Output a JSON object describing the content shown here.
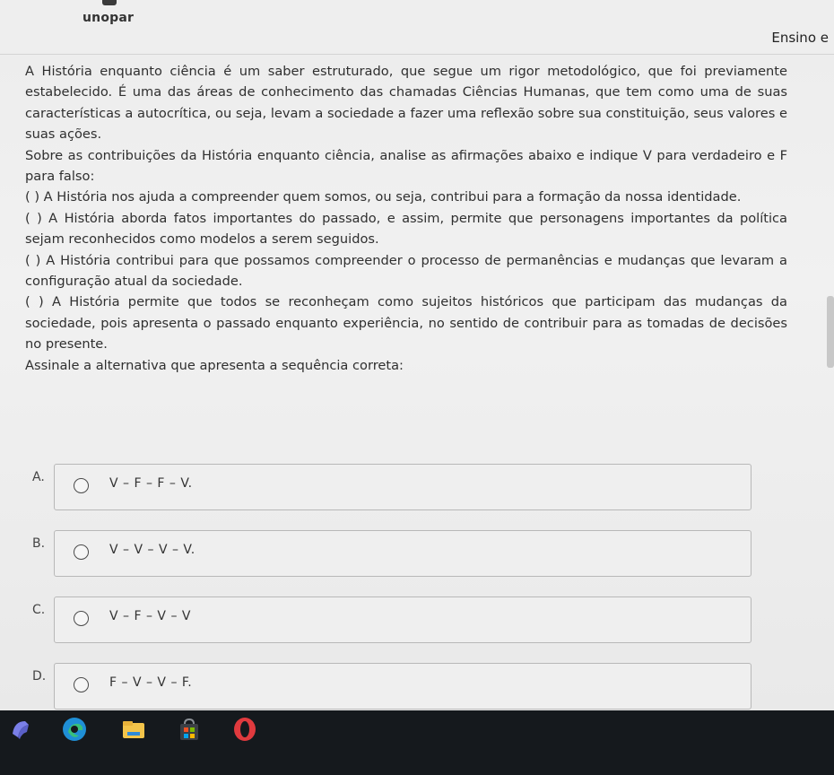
{
  "header": {
    "logo_text": "unopar",
    "course_label": "Ensino e"
  },
  "question": {
    "paragraphs": [
      "A História enquanto ciência é um saber estruturado, que segue um rigor metodológico, que foi previamente estabelecido. É uma das áreas de conhecimento das chamadas Ciências Humanas, que tem como uma de suas características a autocrítica, ou seja, levam a sociedade a fazer uma reflexão sobre sua constituição, seus valores e suas ações.",
      "Sobre as contribuições da História enquanto ciência, analise as afirmações abaixo e indique V para verdadeiro e F para falso:",
      "( ) A História nos ajuda a compreender quem somos, ou seja, contribui para a formação da nossa identidade.",
      "( ) A História aborda fatos importantes do passado, e assim, permite que personagens importantes da política sejam reconhecidos como modelos a serem seguidos.",
      "( ) A História contribui para que possamos compreender o processo de permanências e mudanças que levaram a configuração atual da sociedade.",
      "( ) A História permite que todos se reconheçam como sujeitos históricos que participam das mudanças da sociedade, pois apresenta o passado enquanto experiência, no sentido de contribuir para as tomadas de decisões no presente.",
      "Assinale a alternativa que apresenta a sequência correta:"
    ]
  },
  "options": [
    {
      "letter": "A.",
      "text": "V – F – F – V."
    },
    {
      "letter": "B.",
      "text": "V – V – V – V."
    },
    {
      "letter": "C.",
      "text": "V – F – V – V"
    },
    {
      "letter": "D.",
      "text": "F – V – V – F."
    }
  ],
  "taskbar": {
    "icons": [
      "app-icon",
      "edge-browser-icon",
      "file-explorer-icon",
      "store-icon",
      "opera-browser-icon"
    ]
  },
  "colors": {
    "page_background": "#ececec",
    "text": "#2f2f2f",
    "taskbar": "#15191d",
    "edge_blue": "#1f8fd6",
    "explorer_yellow": "#f3c44a",
    "opera_red": "#e03a3e"
  }
}
